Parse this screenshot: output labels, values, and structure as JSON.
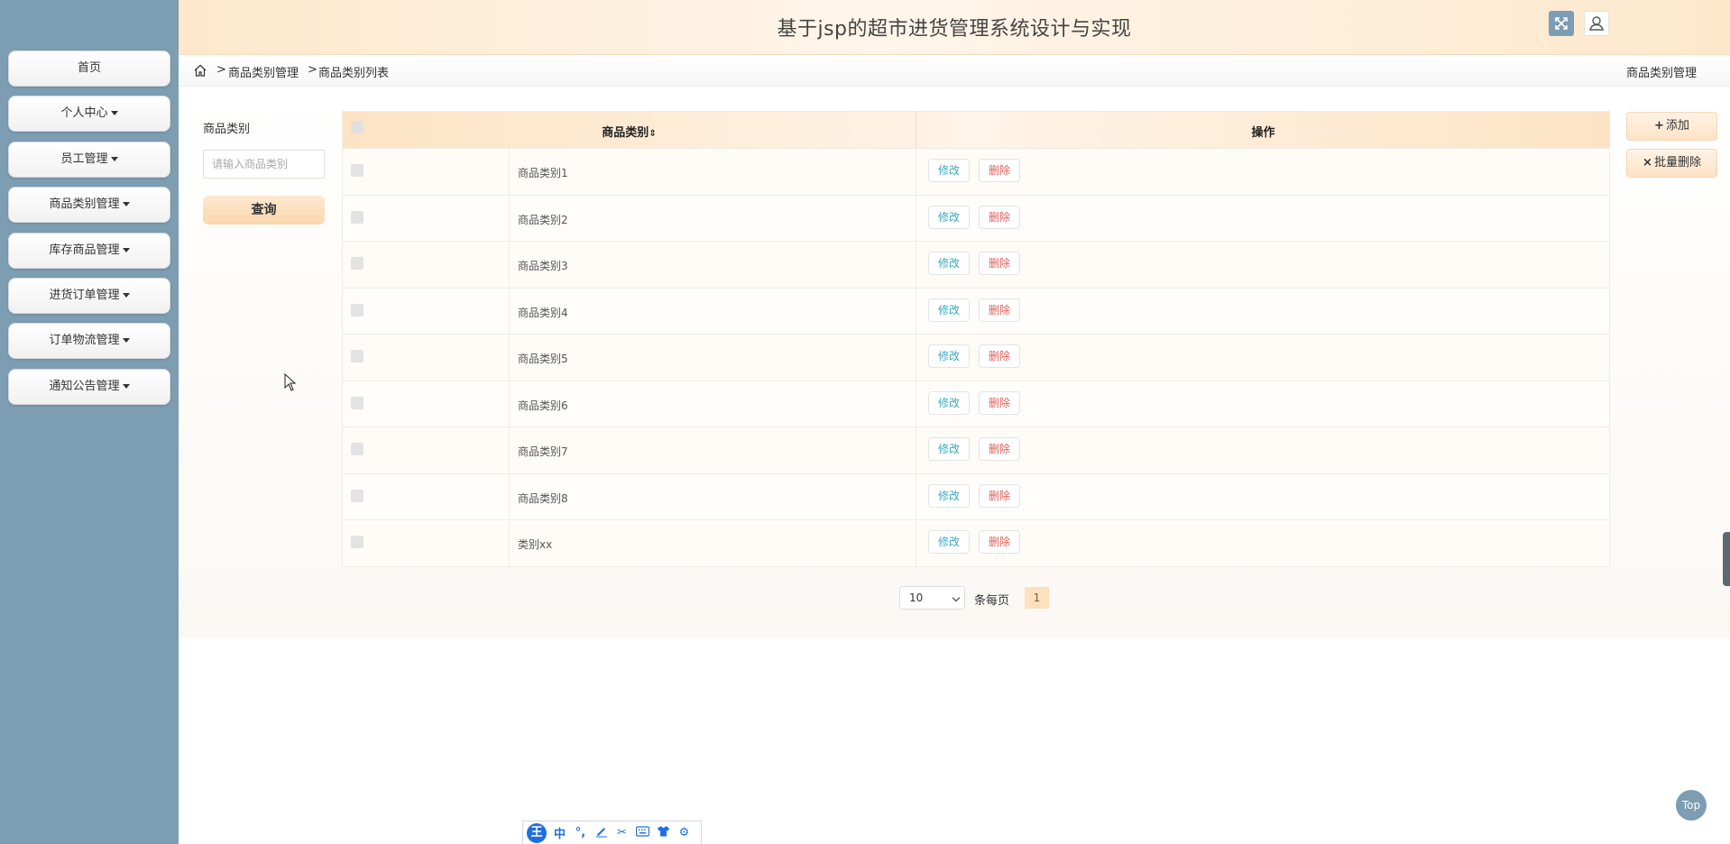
{
  "header": {
    "title": "基于jsp的超市进货管理系统设计与实现"
  },
  "sidebar": {
    "items": [
      {
        "label": "首页",
        "dropdown": false
      },
      {
        "label": "个人中心",
        "dropdown": true
      },
      {
        "label": "员工管理",
        "dropdown": true
      },
      {
        "label": "商品类别管理",
        "dropdown": true
      },
      {
        "label": "库存商品管理",
        "dropdown": true
      },
      {
        "label": "进货订单管理",
        "dropdown": true
      },
      {
        "label": "订单物流管理",
        "dropdown": true
      },
      {
        "label": "通知公告管理",
        "dropdown": true
      }
    ]
  },
  "breadcrumb": {
    "sep": ">",
    "items": [
      "商品类别管理",
      "商品类别列表"
    ],
    "right": "商品类别管理"
  },
  "search": {
    "label": "商品类别",
    "placeholder": "请输入商品类别",
    "button": "查询"
  },
  "actions": {
    "add": "添加",
    "batch_delete": "批量删除"
  },
  "table": {
    "columns": [
      "商品类别",
      "操作"
    ],
    "edit_label": "修改",
    "delete_label": "删除",
    "rows": [
      "商品类别1",
      "商品类别2",
      "商品类别3",
      "商品类别4",
      "商品类别5",
      "商品类别6",
      "商品类别7",
      "商品类别8",
      "类别xx"
    ]
  },
  "pagination": {
    "page_size": "10",
    "per_page_label": "条每页",
    "current_page": "1"
  },
  "misc": {
    "top_button": "Top",
    "ime": {
      "logo": "王",
      "mode": "中"
    }
  },
  "colors": {
    "sidebar": "#7c9db2",
    "accent": "#fde3c4",
    "edit": "#3aa8c1",
    "delete": "#e0605a"
  }
}
